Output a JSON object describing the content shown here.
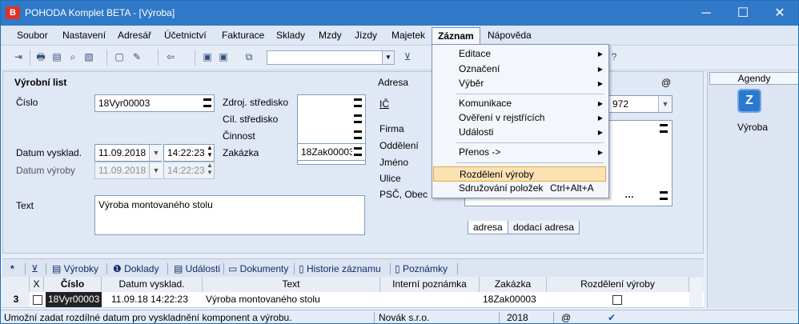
{
  "window": {
    "title": "POHODA Komplet BETA - [Výroba]",
    "app_icon": "B",
    "minimize": "─",
    "maximize": "☐",
    "close": "✕"
  },
  "menu": [
    "Soubor",
    "Nastavení",
    "Adresář",
    "Účetnictví",
    "Fakturace",
    "Sklady",
    "Mzdy",
    "Jízdy",
    "Majetek",
    "Záznam",
    "Nápověda"
  ],
  "toolbar": {
    "help_glyph": "?"
  },
  "form": {
    "section_title": "Výrobní list",
    "cislo_label": "Číslo",
    "cislo_value": "18Vyr00003",
    "zdroj_label": "Zdroj. středisko",
    "cil_label": "Cíl. středisko",
    "cinnost_label": "Činnost",
    "zakazka_label": "Zakázka",
    "zakazka_value": "18Zak00003",
    "datum_vyskl_label": "Datum vysklad.",
    "datum_vyskl_value": "11.09.2018",
    "cas_vyskl_value": "14:22:23",
    "datum_vyroby_label": "Datum výroby",
    "datum_vyroby_value": "11.09.2018",
    "cas_vyroby_value": "14:22:23",
    "text_label": "Text",
    "text_value": "Výroba montovaného stolu",
    "adresa_label": "Adresa",
    "at_label": "@",
    "ic_label": "IČ",
    "ic_value_tail": "972",
    "firma_label": "Firma",
    "oddeleni_label": "Oddělení",
    "jmeno_label": "Jméno",
    "ulice_label": "Ulice",
    "psc_label": "PSČ, Obec",
    "tab_adresa": "adresa",
    "tab_dodaci": "dodací adresa"
  },
  "agendy": {
    "header": "Agendy",
    "item": "Výroba",
    "icon_glyph": "Z"
  },
  "bottom_tabs": [
    "Výrobky",
    "Doklady",
    "Události",
    "Dokumenty",
    "Historie záznamu",
    "Poznámky"
  ],
  "grid": {
    "headers": [
      "X",
      "Číslo",
      "Datum vysklad.",
      "Text",
      "Interní poznámka",
      "Zakázka",
      "Rozdělení výroby"
    ],
    "row": {
      "index": "3",
      "cislo": "18Vyr00003",
      "datum": "11.09.18 14:22:23",
      "text": "Výroba montovaného stolu",
      "poznamka": "",
      "zakazka": "18Zak00003"
    }
  },
  "status": {
    "message": "Umožní zadat rozdílné datum pro vyskladnění komponent a výrobu.",
    "company": "Novák s.r.o.",
    "year": "2018",
    "at": "@"
  },
  "dropdown": {
    "items": [
      {
        "label": "Editace",
        "submenu": true
      },
      {
        "label": "Označení",
        "submenu": true
      },
      {
        "label": "Výběr",
        "submenu": true
      },
      {
        "label": "Komunikace",
        "submenu": true
      },
      {
        "label": "Ověření v rejstřících",
        "submenu": true
      },
      {
        "label": "Události",
        "submenu": true
      },
      {
        "label": "Přenos ->",
        "submenu": true
      },
      {
        "label": "Rozdělení výroby",
        "submenu": false,
        "highlighted": true
      },
      {
        "label": "Sdružování položek",
        "shortcut": "Ctrl+Alt+A",
        "submenu": false
      }
    ]
  }
}
